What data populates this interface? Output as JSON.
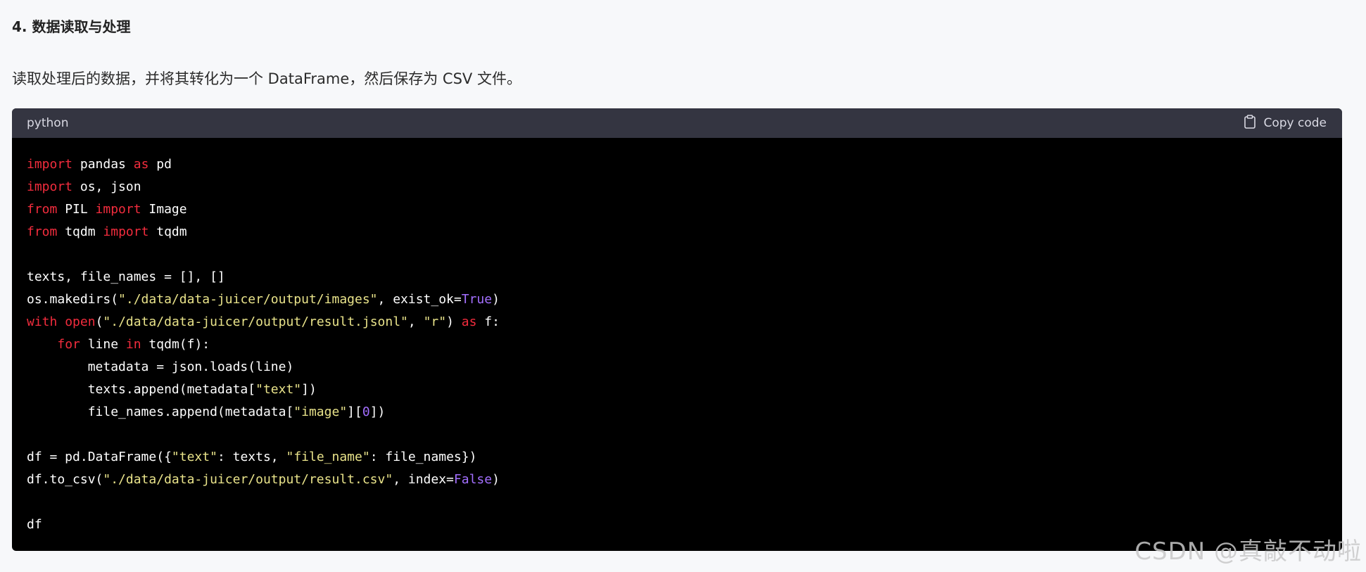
{
  "section": {
    "heading": "4. 数据读取与处理",
    "intro": "读取处理后的数据，并将其转化为一个 DataFrame，然后保存为 CSV 文件。"
  },
  "code_block": {
    "language": "python",
    "copy_label": "Copy code",
    "copy_icon": "clipboard-icon",
    "lines": [
      [
        {
          "t": "import",
          "c": "kw"
        },
        {
          "t": " pandas "
        },
        {
          "t": "as",
          "c": "kw"
        },
        {
          "t": " pd"
        }
      ],
      [
        {
          "t": "import",
          "c": "kw"
        },
        {
          "t": " os, json"
        }
      ],
      [
        {
          "t": "from",
          "c": "kw"
        },
        {
          "t": " PIL "
        },
        {
          "t": "import",
          "c": "kw"
        },
        {
          "t": " Image"
        }
      ],
      [
        {
          "t": "from",
          "c": "kw"
        },
        {
          "t": " tqdm "
        },
        {
          "t": "import",
          "c": "kw"
        },
        {
          "t": " tqdm"
        }
      ],
      [],
      [
        {
          "t": "texts, file_names = [], []"
        }
      ],
      [
        {
          "t": "os.makedirs("
        },
        {
          "t": "\"./data/data-juicer/output/images\"",
          "c": "str"
        },
        {
          "t": ", exist_ok="
        },
        {
          "t": "True",
          "c": "num"
        },
        {
          "t": ")"
        }
      ],
      [
        {
          "t": "with",
          "c": "kw"
        },
        {
          "t": " "
        },
        {
          "t": "open",
          "c": "kw"
        },
        {
          "t": "("
        },
        {
          "t": "\"./data/data-juicer/output/result.jsonl\"",
          "c": "str"
        },
        {
          "t": ", "
        },
        {
          "t": "\"r\"",
          "c": "str"
        },
        {
          "t": ") "
        },
        {
          "t": "as",
          "c": "kw"
        },
        {
          "t": " f:"
        }
      ],
      [
        {
          "t": "    "
        },
        {
          "t": "for",
          "c": "kw"
        },
        {
          "t": " line "
        },
        {
          "t": "in",
          "c": "kw"
        },
        {
          "t": " tqdm(f):"
        }
      ],
      [
        {
          "t": "        metadata = json.loads(line)"
        }
      ],
      [
        {
          "t": "        texts.append(metadata["
        },
        {
          "t": "\"text\"",
          "c": "str"
        },
        {
          "t": "])"
        }
      ],
      [
        {
          "t": "        file_names.append(metadata["
        },
        {
          "t": "\"image\"",
          "c": "str"
        },
        {
          "t": "]["
        },
        {
          "t": "0",
          "c": "num"
        },
        {
          "t": "])"
        }
      ],
      [],
      [
        {
          "t": "df = pd.DataFrame({"
        },
        {
          "t": "\"text\"",
          "c": "str"
        },
        {
          "t": ": texts, "
        },
        {
          "t": "\"file_name\"",
          "c": "str"
        },
        {
          "t": ": file_names})"
        }
      ],
      [
        {
          "t": "df.to_csv("
        },
        {
          "t": "\"./data/data-juicer/output/result.csv\"",
          "c": "str"
        },
        {
          "t": ", index="
        },
        {
          "t": "False",
          "c": "num"
        },
        {
          "t": ")"
        }
      ],
      [],
      [
        {
          "t": "df"
        }
      ]
    ]
  },
  "watermark": "CSDN @真敲不动啦",
  "colors": {
    "keyword": "#f22c3d",
    "string": "#e9e38a",
    "literal": "#a36fff",
    "code_bg": "#000000",
    "header_bg": "#343541"
  }
}
